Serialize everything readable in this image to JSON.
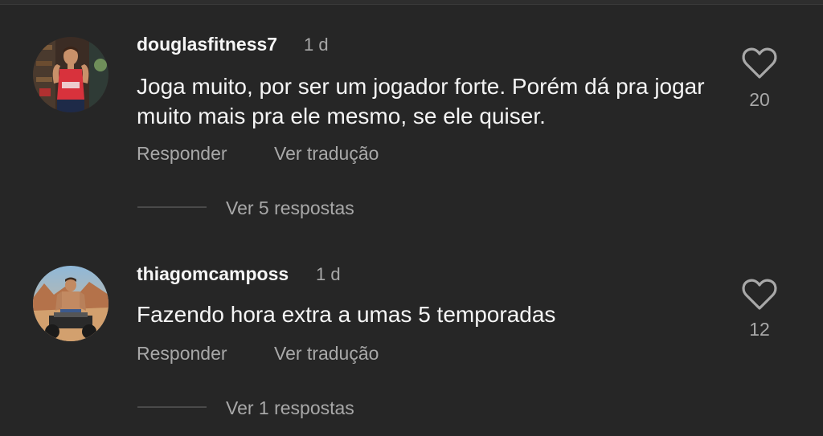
{
  "comments": [
    {
      "username": "douglasfitness7",
      "time": "1 d",
      "text": "Joga muito, por ser um jogador forte. Porém dá pra jogar muito mais pra ele mesmo, se ele quiser.",
      "reply_label": "Responder",
      "translate_label": "Ver tradução",
      "likes": "20",
      "view_replies": "Ver 5 respostas",
      "like_icon": "heart-outline-icon"
    },
    {
      "username": "thiagomcamposs",
      "time": "1 d",
      "text": "Fazendo hora extra a umas 5 temporadas",
      "reply_label": "Responder",
      "translate_label": "Ver tradução",
      "likes": "12",
      "view_replies": "Ver 1 respostas",
      "like_icon": "heart-outline-icon"
    }
  ],
  "colors": {
    "background": "#262626",
    "primary_text": "#f5f5f5",
    "secondary_text": "#a8a8a8"
  }
}
